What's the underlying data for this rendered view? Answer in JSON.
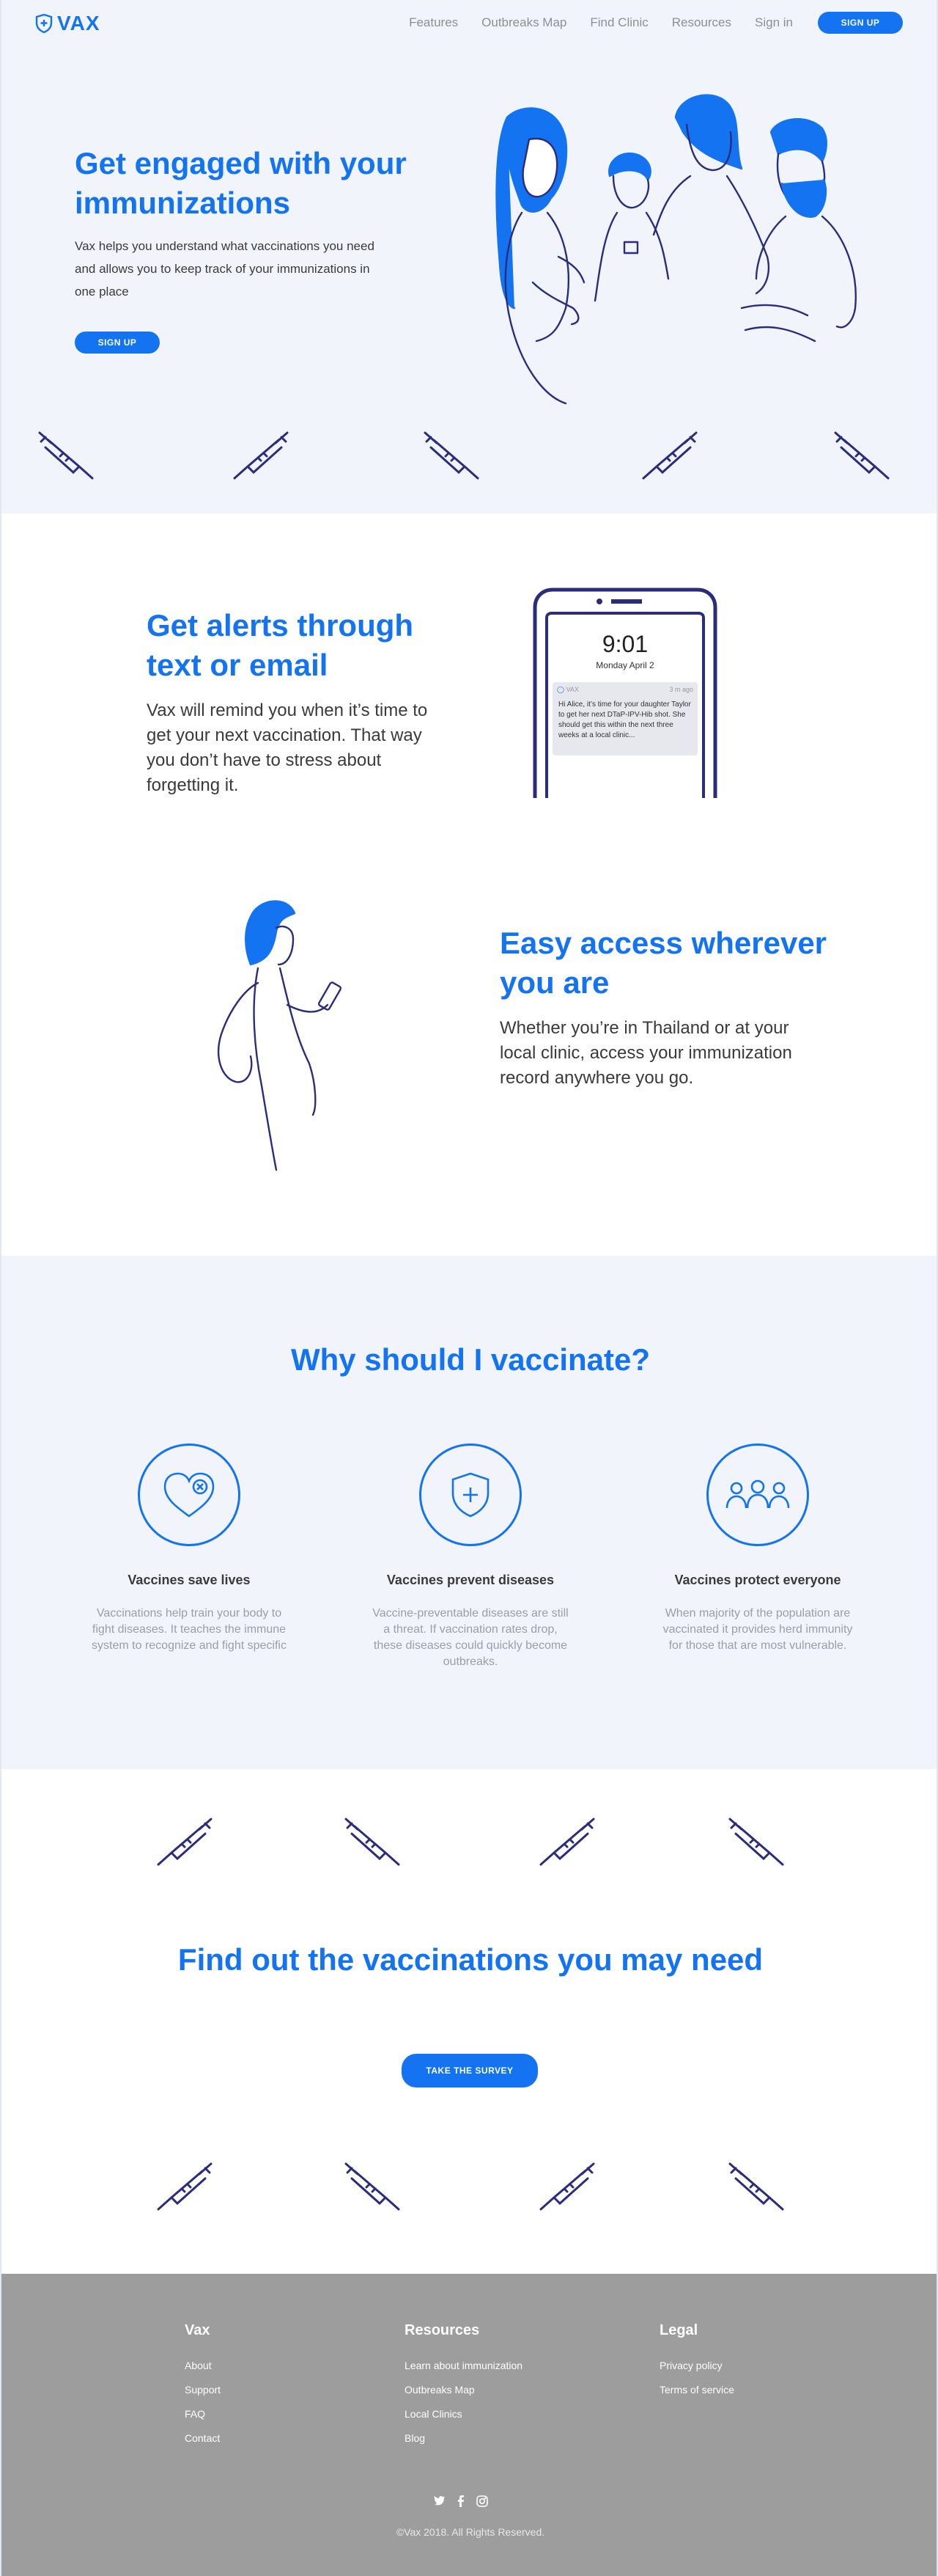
{
  "header": {
    "logo": "VAX",
    "nav": [
      "Features",
      "Outbreaks Map",
      "Find Clinic",
      "Resources",
      "Sign in"
    ],
    "signup": "SIGN UP"
  },
  "hero": {
    "title": "Get engaged with your immunizations",
    "text": "Vax helps you understand what vaccinations you need and allows you to keep track of your immunizations in one place",
    "button": "SIGN UP"
  },
  "alerts": {
    "title": "Get alerts through text or email",
    "text": "Vax will remind you when it’s time to get your next vaccination. That way you don’t have to stress about forgetting it.",
    "phone": {
      "time": "9:01",
      "date": "Monday April 2",
      "app": "VAX",
      "ago": "3 m ago",
      "message": "Hi Alice, it’s time for your daughter Taylor to get her next DTaP-IPV-Hib shot. She should get this within the next three weeks at a local clinic..."
    }
  },
  "access": {
    "title": "Easy access wherever you are",
    "text": "Whether you’re in Thailand or at your local clinic, access your immunization record anywhere you go."
  },
  "why": {
    "title": "Why should I vaccinate?",
    "items": [
      {
        "icon": "heart-icon",
        "title": "Vaccines save lives",
        "text": "Vaccinations help train your body to fight diseases. It teaches the immune system to recognize and fight specific"
      },
      {
        "icon": "shield-icon",
        "title": "Vaccines prevent diseases",
        "text": "Vaccine-preventable diseases are still a threat. If vaccination rates drop, these diseases could quickly become outbreaks."
      },
      {
        "icon": "people-icon",
        "title": "Vaccines protect everyone",
        "text": "When majority of the population are vaccinated it provides herd immunity for those that are most vulnerable."
      }
    ]
  },
  "survey": {
    "title": "Find out the vaccinations you may need",
    "button": "TAKE THE SURVEY"
  },
  "footer": {
    "cols": [
      {
        "title": "Vax",
        "links": [
          "About",
          "Support",
          "FAQ",
          "Contact"
        ]
      },
      {
        "title": "Resources",
        "links": [
          "Learn about immunization",
          "Outbreaks Map",
          "Local Clinics",
          "Blog"
        ]
      },
      {
        "title": "Legal",
        "links": [
          "Privacy policy",
          "Terms of service"
        ]
      }
    ],
    "copyright": "©Vax 2018. All Rights Reserved."
  }
}
